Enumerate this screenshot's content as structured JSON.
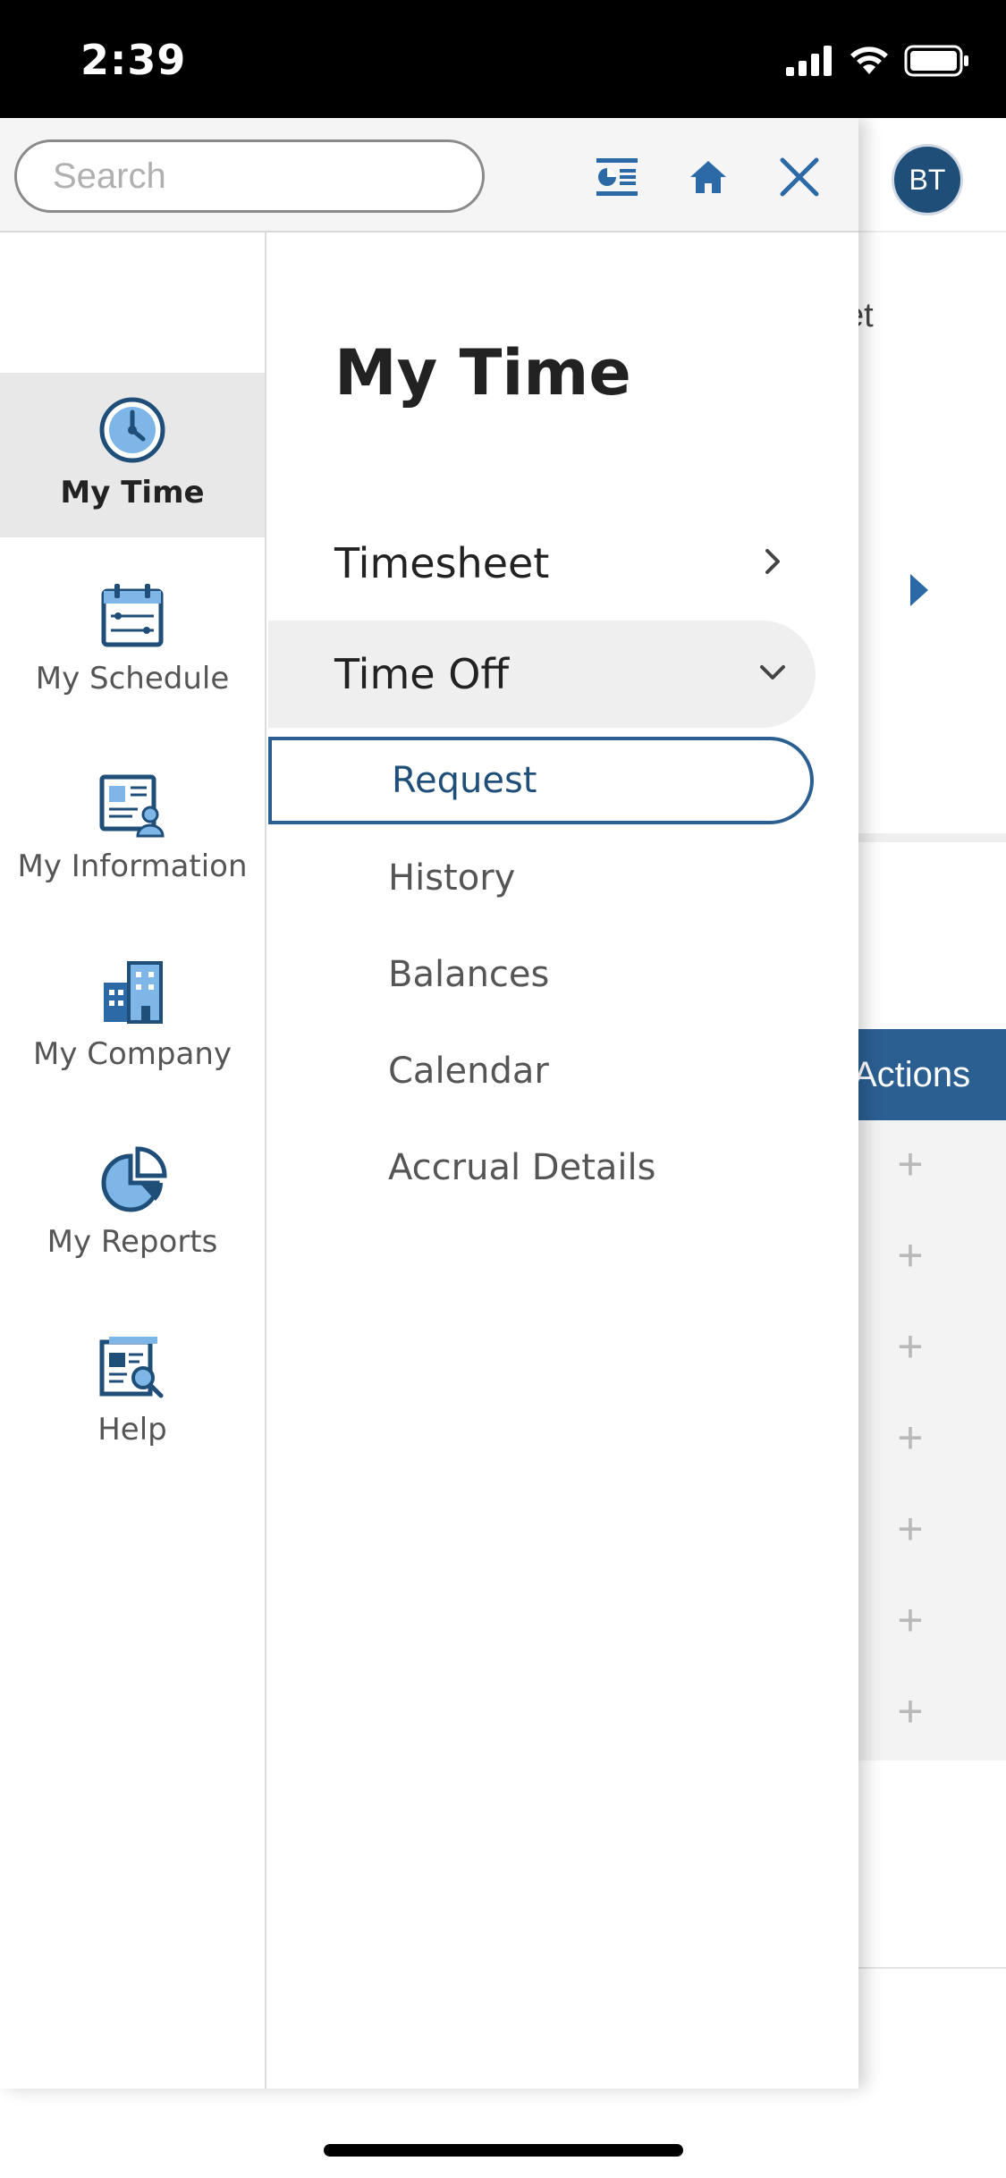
{
  "status_bar": {
    "time": "2:39"
  },
  "background": {
    "avatar_initials": "BT",
    "partial_text": "et",
    "actions_label": "Actions",
    "plus_symbol": "+"
  },
  "drawer": {
    "search": {
      "placeholder": "Search"
    },
    "rail": [
      {
        "label": "My Time",
        "icon": "clock-icon",
        "active": true
      },
      {
        "label": "My Schedule",
        "icon": "calendar-icon",
        "active": false
      },
      {
        "label": "My Information",
        "icon": "profile-card-icon",
        "active": false
      },
      {
        "label": "My Company",
        "icon": "building-icon",
        "active": false
      },
      {
        "label": "My Reports",
        "icon": "pie-chart-icon",
        "active": false
      },
      {
        "label": "Help",
        "icon": "document-search-icon",
        "active": false
      }
    ],
    "menu": {
      "title": "My Time",
      "items": [
        {
          "label": "Timesheet",
          "state": "collapsed"
        },
        {
          "label": "Time Off",
          "state": "expanded"
        }
      ],
      "time_off_subitems": [
        {
          "label": "Request",
          "selected": true
        },
        {
          "label": "History"
        },
        {
          "label": "Balances"
        },
        {
          "label": "Calendar"
        },
        {
          "label": "Accrual Details"
        }
      ]
    }
  },
  "colors": {
    "accent": "#2b5f92",
    "icon_light": "#7fb6e8",
    "icon_dark": "#1f4e79"
  }
}
